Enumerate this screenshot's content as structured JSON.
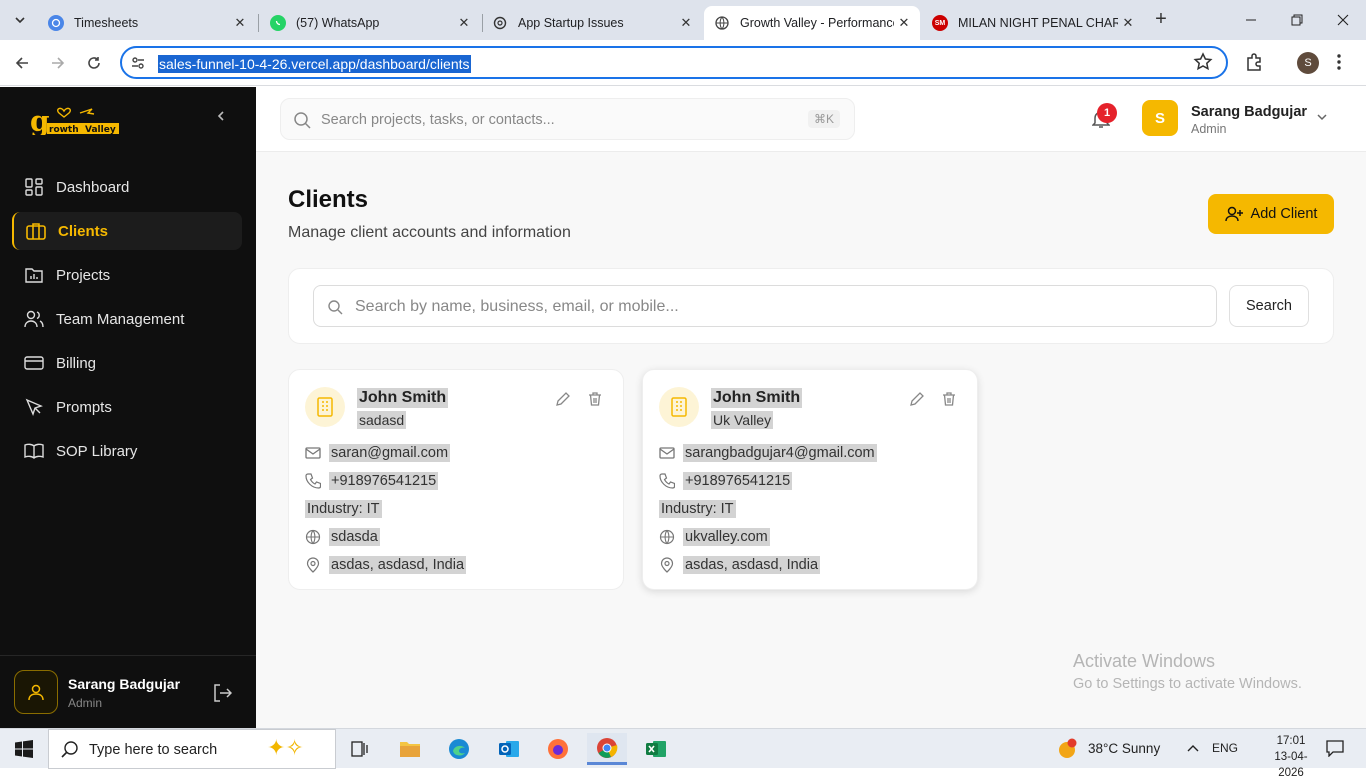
{
  "browser": {
    "tabs": [
      {
        "title": "Timesheets",
        "icon": "timesheets-favicon"
      },
      {
        "title": "(57) WhatsApp",
        "icon": "whatsapp-favicon"
      },
      {
        "title": "App Startup Issues",
        "icon": "chatgpt-favicon"
      },
      {
        "title": "Growth Valley - Performance",
        "icon": "globe-favicon",
        "active": true
      },
      {
        "title": "MILAN NIGHT PENAL CHART",
        "icon": "sm-favicon"
      }
    ],
    "url": "sales-funnel-10-4-26.vercel.app/dashboard/clients",
    "profile_initial": "S"
  },
  "sidebar": {
    "brand": "Growth Valley",
    "items": [
      {
        "label": "Dashboard",
        "icon": "dashboard-icon"
      },
      {
        "label": "Clients",
        "icon": "briefcase-icon",
        "active": true
      },
      {
        "label": "Projects",
        "icon": "projects-icon"
      },
      {
        "label": "Team Management",
        "icon": "users-icon"
      },
      {
        "label": "Billing",
        "icon": "card-icon"
      },
      {
        "label": "Prompts",
        "icon": "prompt-icon"
      },
      {
        "label": "SOP Library",
        "icon": "book-icon"
      }
    ],
    "user": {
      "name": "Sarang Badgujar",
      "role": "Admin"
    }
  },
  "header": {
    "search_placeholder": "Search projects, tasks, or contacts...",
    "shortcut": "⌘K",
    "notifications": "1",
    "user": {
      "initial": "S",
      "name": "Sarang Badgujar",
      "role": "Admin"
    }
  },
  "page": {
    "title": "Clients",
    "subtitle": "Manage client accounts and information",
    "add_button": "Add Client",
    "search_placeholder": "Search by name, business, email, or mobile...",
    "search_button": "Search"
  },
  "clients": [
    {
      "name": "John Smith",
      "business": "sadasd",
      "email": "saran@gmail.com",
      "phone": "+918976541215",
      "industry": "Industry: IT",
      "website": "sdasda",
      "address": "asdas, asdasd, India"
    },
    {
      "name": "John Smith",
      "business": "Uk Valley",
      "email": "sarangbadgujar4@gmail.com",
      "phone": "+918976541215",
      "industry": "Industry: IT",
      "website": "ukvalley.com",
      "address": "asdas, asdasd, India"
    }
  ],
  "watermark": {
    "line1": "Activate Windows",
    "line2": "Go to Settings to activate Windows."
  },
  "taskbar": {
    "search_placeholder": "Type here to search",
    "weather": "38°C  Sunny",
    "lang": "ENG",
    "time": "17:01",
    "date": "13-04-2026"
  },
  "colors": {
    "accent": "#f5b800",
    "sidebar_bg": "#0f0f0f",
    "badge": "#e5222b"
  }
}
